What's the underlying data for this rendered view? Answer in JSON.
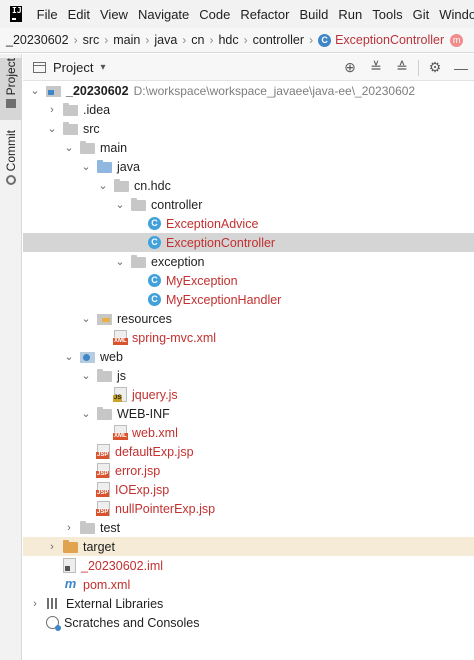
{
  "menu": {
    "items": [
      "File",
      "Edit",
      "View",
      "Navigate",
      "Code",
      "Refactor",
      "Build",
      "Run",
      "Tools",
      "Git",
      "Windo"
    ]
  },
  "breadcrumb": {
    "items": [
      "_20230602",
      "src",
      "main",
      "java",
      "cn",
      "hdc",
      "controller"
    ],
    "active": "ExceptionController",
    "class_icon_letter": "C",
    "next_icon_letter": "m"
  },
  "toolstrip": {
    "project_label": "Project",
    "commit_label": "Commit"
  },
  "project_panel": {
    "title": "Project",
    "tools": [
      "target-icon",
      "expand-all-icon",
      "collapse-all-icon",
      "gear-icon",
      "minimize-icon"
    ]
  },
  "tree": {
    "root": {
      "name": "_20230602",
      "path": "D:\\workspace\\workspace_javaee\\java-ee\\_20230602"
    },
    "idea": ".idea",
    "src": "src",
    "main": "main",
    "java": "java",
    "cnhdc": "cn.hdc",
    "controller": "controller",
    "exception_advice": "ExceptionAdvice",
    "exception_controller": "ExceptionController",
    "exception_pkg": "exception",
    "my_exception": "MyException",
    "my_exception_handler": "MyExceptionHandler",
    "resources": "resources",
    "spring_mvc": "spring-mvc.xml",
    "web": "web",
    "js": "js",
    "jquery": "jquery.js",
    "webinf": "WEB-INF",
    "webxml": "web.xml",
    "default_exp": "defaultExp.jsp",
    "error": "error.jsp",
    "ioexp": "IOExp.jsp",
    "nullptr": "nullPointerExp.jsp",
    "test": "test",
    "target": "target",
    "iml": "_20230602.iml",
    "pom": "pom.xml",
    "ext_libs": "External Libraries",
    "scratches": "Scratches and Consoles",
    "class_letter": "C",
    "tag_jsp": "JSP",
    "tag_js": "JS",
    "tag_xml": "XML",
    "maven_letter": "m"
  },
  "colors": {
    "selection": "#d5d5d5",
    "error_text": "#c2302f",
    "class_icon": "#41a1db"
  }
}
